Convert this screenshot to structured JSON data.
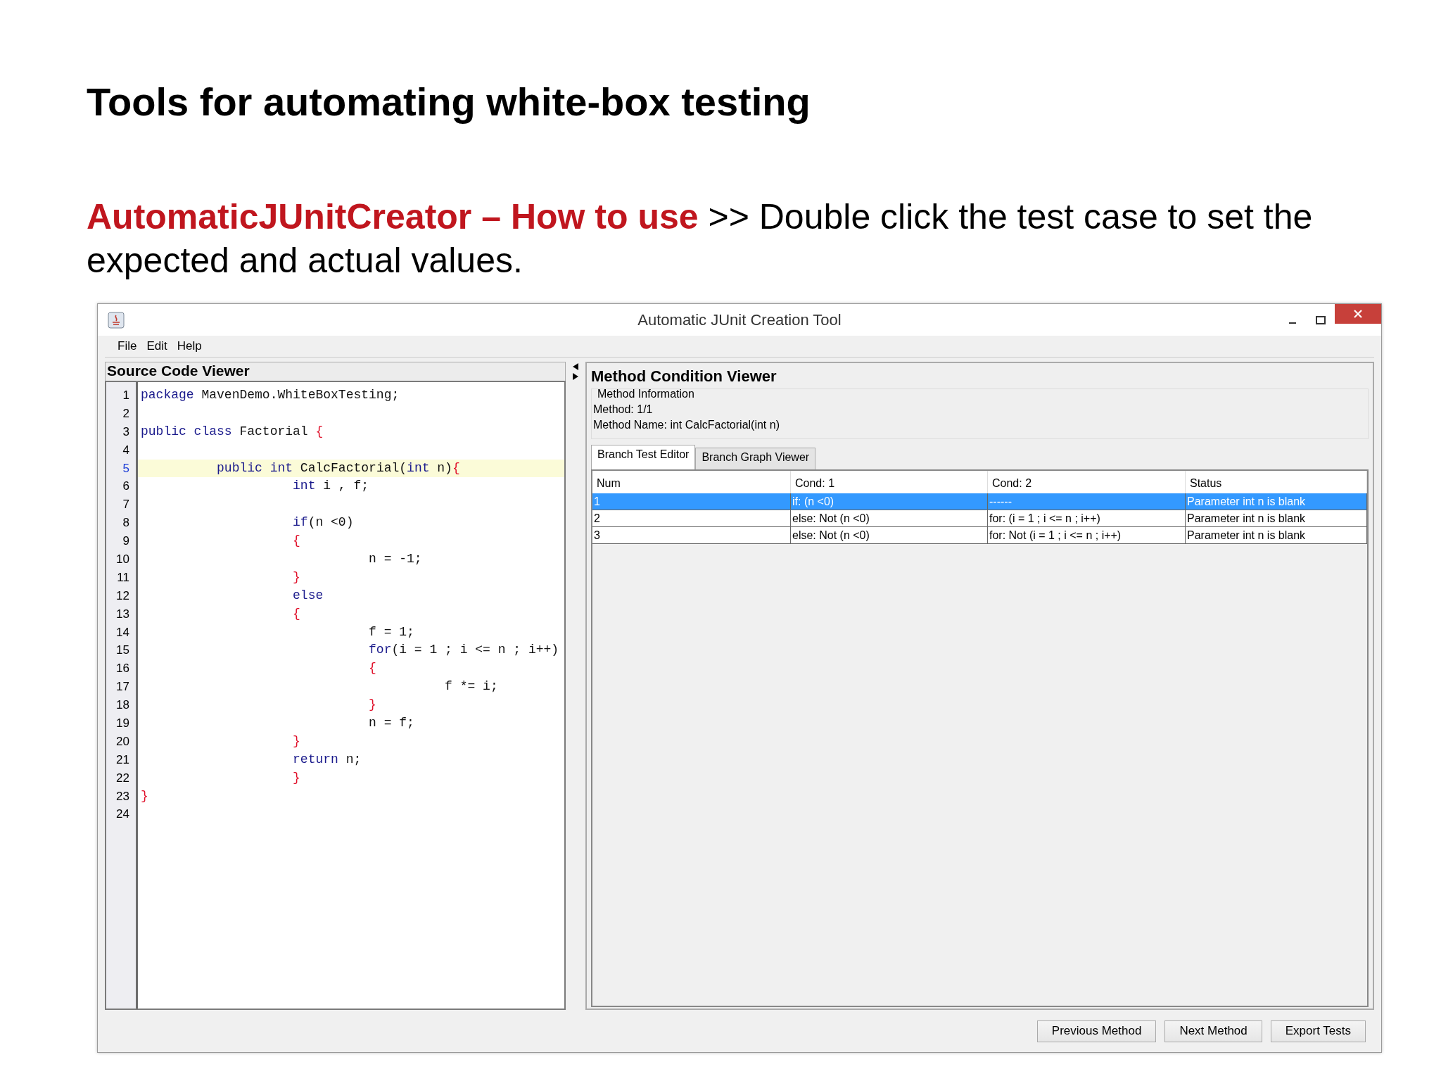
{
  "slide": {
    "title": "Tools for automating white-box testing",
    "subtitle": {
      "lead": "AutomaticJUnitCreator – How to use",
      "text": " >> Double click the test case to set the expected and actual values."
    }
  },
  "window": {
    "title": "Automatic JUnit Creation Tool"
  },
  "menu": [
    "File",
    "Edit",
    "Help"
  ],
  "source_viewer": {
    "title": "Source Code Viewer",
    "lines": [
      {
        "num": "1",
        "current": false,
        "tokens": [
          {
            "kind": "keyword",
            "text": "package"
          },
          {
            "kind": "plain",
            "text": " MavenDemo.WhiteBoxTesting;"
          }
        ]
      },
      {
        "num": "2",
        "current": false
      },
      {
        "num": "3",
        "current": false,
        "tokens": [
          {
            "kind": "keyword",
            "text": "public class"
          },
          {
            "kind": "plain",
            "text": " Factorial "
          },
          {
            "kind": "brace",
            "text": "{"
          }
        ]
      },
      {
        "num": "4",
        "current": false
      },
      {
        "num": "5",
        "current": true,
        "tokens": [
          {
            "kind": "keyword",
            "text": "\tpublic int"
          },
          {
            "kind": "plain",
            "text": " CalcFactorial("
          },
          {
            "kind": "keyword",
            "text": "int"
          },
          {
            "kind": "plain",
            "text": " n)"
          },
          {
            "kind": "brace",
            "text": "{"
          }
        ]
      },
      {
        "num": "6",
        "current": false,
        "tokens": [
          {
            "kind": "keyword",
            "text": "\t\tint"
          },
          {
            "kind": "plain",
            "text": " i , f;"
          }
        ]
      },
      {
        "num": "7",
        "current": false
      },
      {
        "num": "8",
        "current": false,
        "tokens": [
          {
            "kind": "keyword",
            "text": "\t\tif"
          },
          {
            "kind": "plain",
            "text": "(n <0)"
          }
        ]
      },
      {
        "num": "9",
        "current": false,
        "tokens": [
          {
            "kind": "brace",
            "text": "\t\t{"
          }
        ]
      },
      {
        "num": "10",
        "current": false,
        "tokens": [
          {
            "kind": "plain",
            "text": "\t\t\tn = -1;"
          }
        ]
      },
      {
        "num": "11",
        "current": false,
        "tokens": [
          {
            "kind": "brace",
            "text": "\t\t}"
          }
        ]
      },
      {
        "num": "12",
        "current": false,
        "tokens": [
          {
            "kind": "keyword",
            "text": "\t\telse"
          }
        ]
      },
      {
        "num": "13",
        "current": false,
        "tokens": [
          {
            "kind": "brace",
            "text": "\t\t{"
          }
        ]
      },
      {
        "num": "14",
        "current": false,
        "tokens": [
          {
            "kind": "plain",
            "text": "\t\t\tf = 1;"
          }
        ]
      },
      {
        "num": "15",
        "current": false,
        "tokens": [
          {
            "kind": "keyword",
            "text": "\t\t\tfor"
          },
          {
            "kind": "plain",
            "text": "(i = 1 ; i <= n ; i++)"
          }
        ]
      },
      {
        "num": "16",
        "current": false,
        "tokens": [
          {
            "kind": "brace",
            "text": "\t\t\t{"
          }
        ]
      },
      {
        "num": "17",
        "current": false,
        "tokens": [
          {
            "kind": "plain",
            "text": "\t\t\t\tf *= i;"
          }
        ]
      },
      {
        "num": "18",
        "current": false,
        "tokens": [
          {
            "kind": "brace",
            "text": "\t\t\t}"
          }
        ]
      },
      {
        "num": "19",
        "current": false,
        "tokens": [
          {
            "kind": "plain",
            "text": "\t\t\tn = f;"
          }
        ]
      },
      {
        "num": "20",
        "current": false,
        "tokens": [
          {
            "kind": "brace",
            "text": "\t\t}"
          }
        ]
      },
      {
        "num": "21",
        "current": false,
        "tokens": [
          {
            "kind": "keyword",
            "text": "\t\treturn"
          },
          {
            "kind": "plain",
            "text": " n;"
          }
        ]
      },
      {
        "num": "22",
        "current": false,
        "tokens": [
          {
            "kind": "brace",
            "text": "\t\t}"
          }
        ]
      },
      {
        "num": "23",
        "current": false,
        "tokens": [
          {
            "kind": "brace",
            "text": "}"
          }
        ]
      },
      {
        "num": "24",
        "current": false
      }
    ]
  },
  "condition_viewer": {
    "title": "Method Condition Viewer",
    "info": {
      "legend": "Method Information",
      "method": "Method: 1/1",
      "method_name": "Method Name: int CalcFactorial(int n)"
    },
    "tabs": [
      {
        "label": "Branch Test Editor",
        "selected": true
      },
      {
        "label": "Branch Graph Viewer",
        "selected": false
      }
    ],
    "table": {
      "columns": [
        "Num",
        "Cond: 1",
        "Cond: 2",
        "Status"
      ],
      "rows": [
        {
          "cells": [
            "1",
            "if: (n <0)",
            "------",
            "Parameter int n is  blank"
          ],
          "selected": true
        },
        {
          "cells": [
            "2",
            "else: Not (n <0)",
            "for: (i = 1 ; i <= n ; i++)",
            "Parameter int n is  blank"
          ],
          "selected": false
        },
        {
          "cells": [
            "3",
            "else: Not (n <0)",
            "for: Not (i = 1 ; i <= n ; i++)",
            "Parameter int n is  blank"
          ],
          "selected": false
        }
      ]
    }
  },
  "buttons": [
    "Previous Method",
    "Next Method",
    "Export Tests"
  ]
}
